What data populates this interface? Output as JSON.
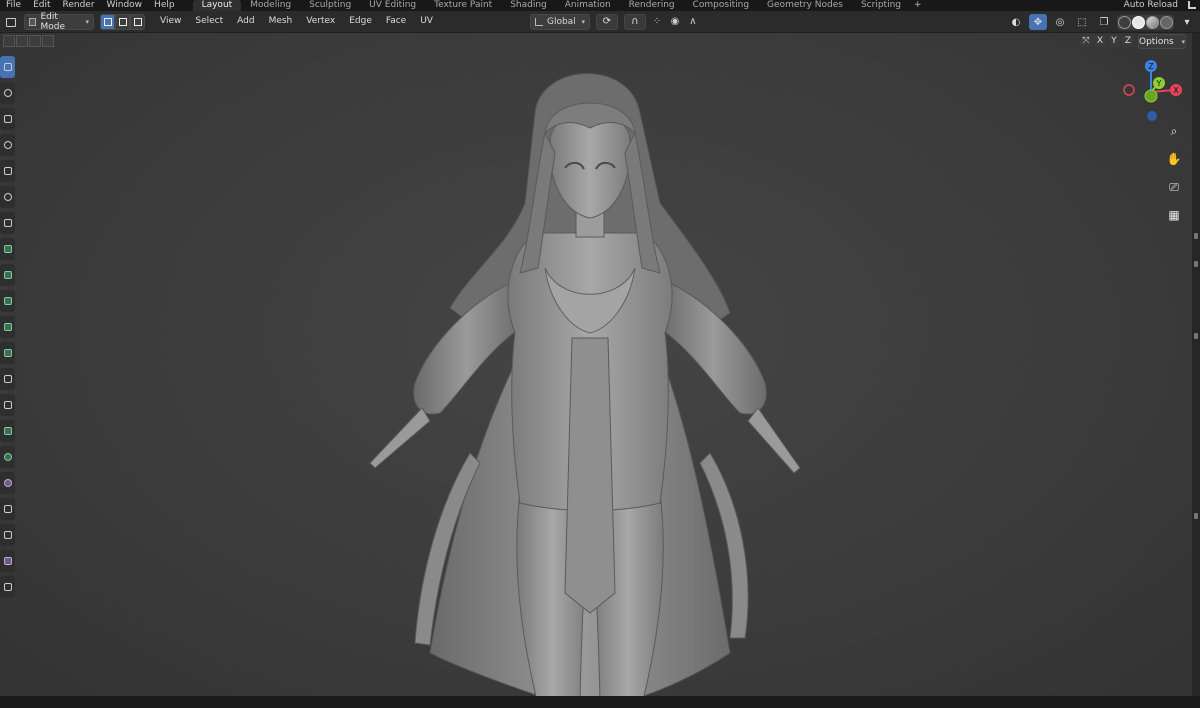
{
  "menu": [
    "File",
    "Edit",
    "Render",
    "Window",
    "Help"
  ],
  "workspaces": [
    {
      "label": "Layout",
      "active": true
    },
    {
      "label": "Modeling"
    },
    {
      "label": "Sculpting"
    },
    {
      "label": "UV Editing"
    },
    {
      "label": "Texture Paint"
    },
    {
      "label": "Shading"
    },
    {
      "label": "Animation"
    },
    {
      "label": "Rendering"
    },
    {
      "label": "Compositing"
    },
    {
      "label": "Geometry Nodes"
    },
    {
      "label": "Scripting"
    }
  ],
  "workspace_add": "+",
  "auto_reload": "Auto Reload",
  "header": {
    "mode": "Edit Mode",
    "menu": [
      "View",
      "Select",
      "Add",
      "Mesh",
      "Vertex",
      "Edge",
      "Face",
      "UV"
    ],
    "orientation": "Global"
  },
  "subbar": {
    "axes": [
      "X",
      "Y",
      "Z"
    ],
    "options": "Options"
  },
  "gizmo": {
    "x": "X",
    "y": "Y",
    "z": "Z"
  },
  "colors": {
    "accent": "#4772b3",
    "axis_x": "#e2445a",
    "axis_y": "#8bd12f",
    "axis_z": "#3e82e6",
    "tool_green": "#6fd49c",
    "tool_purple": "#c7a3e6"
  },
  "toolbar_icons": [
    "select-box-icon",
    "cursor-icon",
    "move-icon",
    "rotate-icon",
    "scale-icon",
    "transform-icon",
    "annotate-icon",
    "measure-icon",
    "add-cube-icon",
    "extrude-icon",
    "inset-icon",
    "bevel-icon",
    "loop-cut-icon",
    "knife-icon",
    "poly-build-icon",
    "spin-icon",
    "smooth-icon",
    "edge-slide-icon",
    "shrink-fatten-icon",
    "shear-icon",
    "rip-icon"
  ]
}
